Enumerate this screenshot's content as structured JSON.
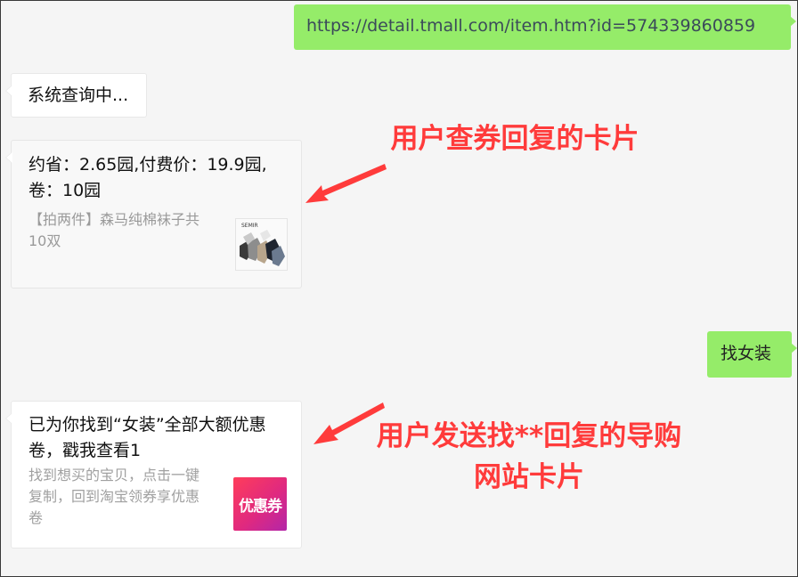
{
  "messages": {
    "url": "https://detail.tmall.com/item.htm?id=574339860859",
    "query_status": "系统查询中...",
    "card1": {
      "title": "约省：2.65园,付费价：19.9园,卷：10园",
      "desc": "【拍两件】森马纯棉袜子共10双",
      "thumb_logo": "SEMIR"
    },
    "find_request": "找女装",
    "card2": {
      "title": "已为你找到“女装”全部大额优惠卷，戳我查看1",
      "desc": "找到想买的宝贝，点击一键复制，回到淘宝领券享优惠卷",
      "coupon_label": "优惠券"
    }
  },
  "annotations": {
    "card1_note": "用户查券回复的卡片",
    "card2_note": "用户发送找**回复的导购网站卡片"
  },
  "colors": {
    "sent_bubble": "#95ec69",
    "annotation": "#ff3b3b",
    "background": "#f5f5f5"
  }
}
